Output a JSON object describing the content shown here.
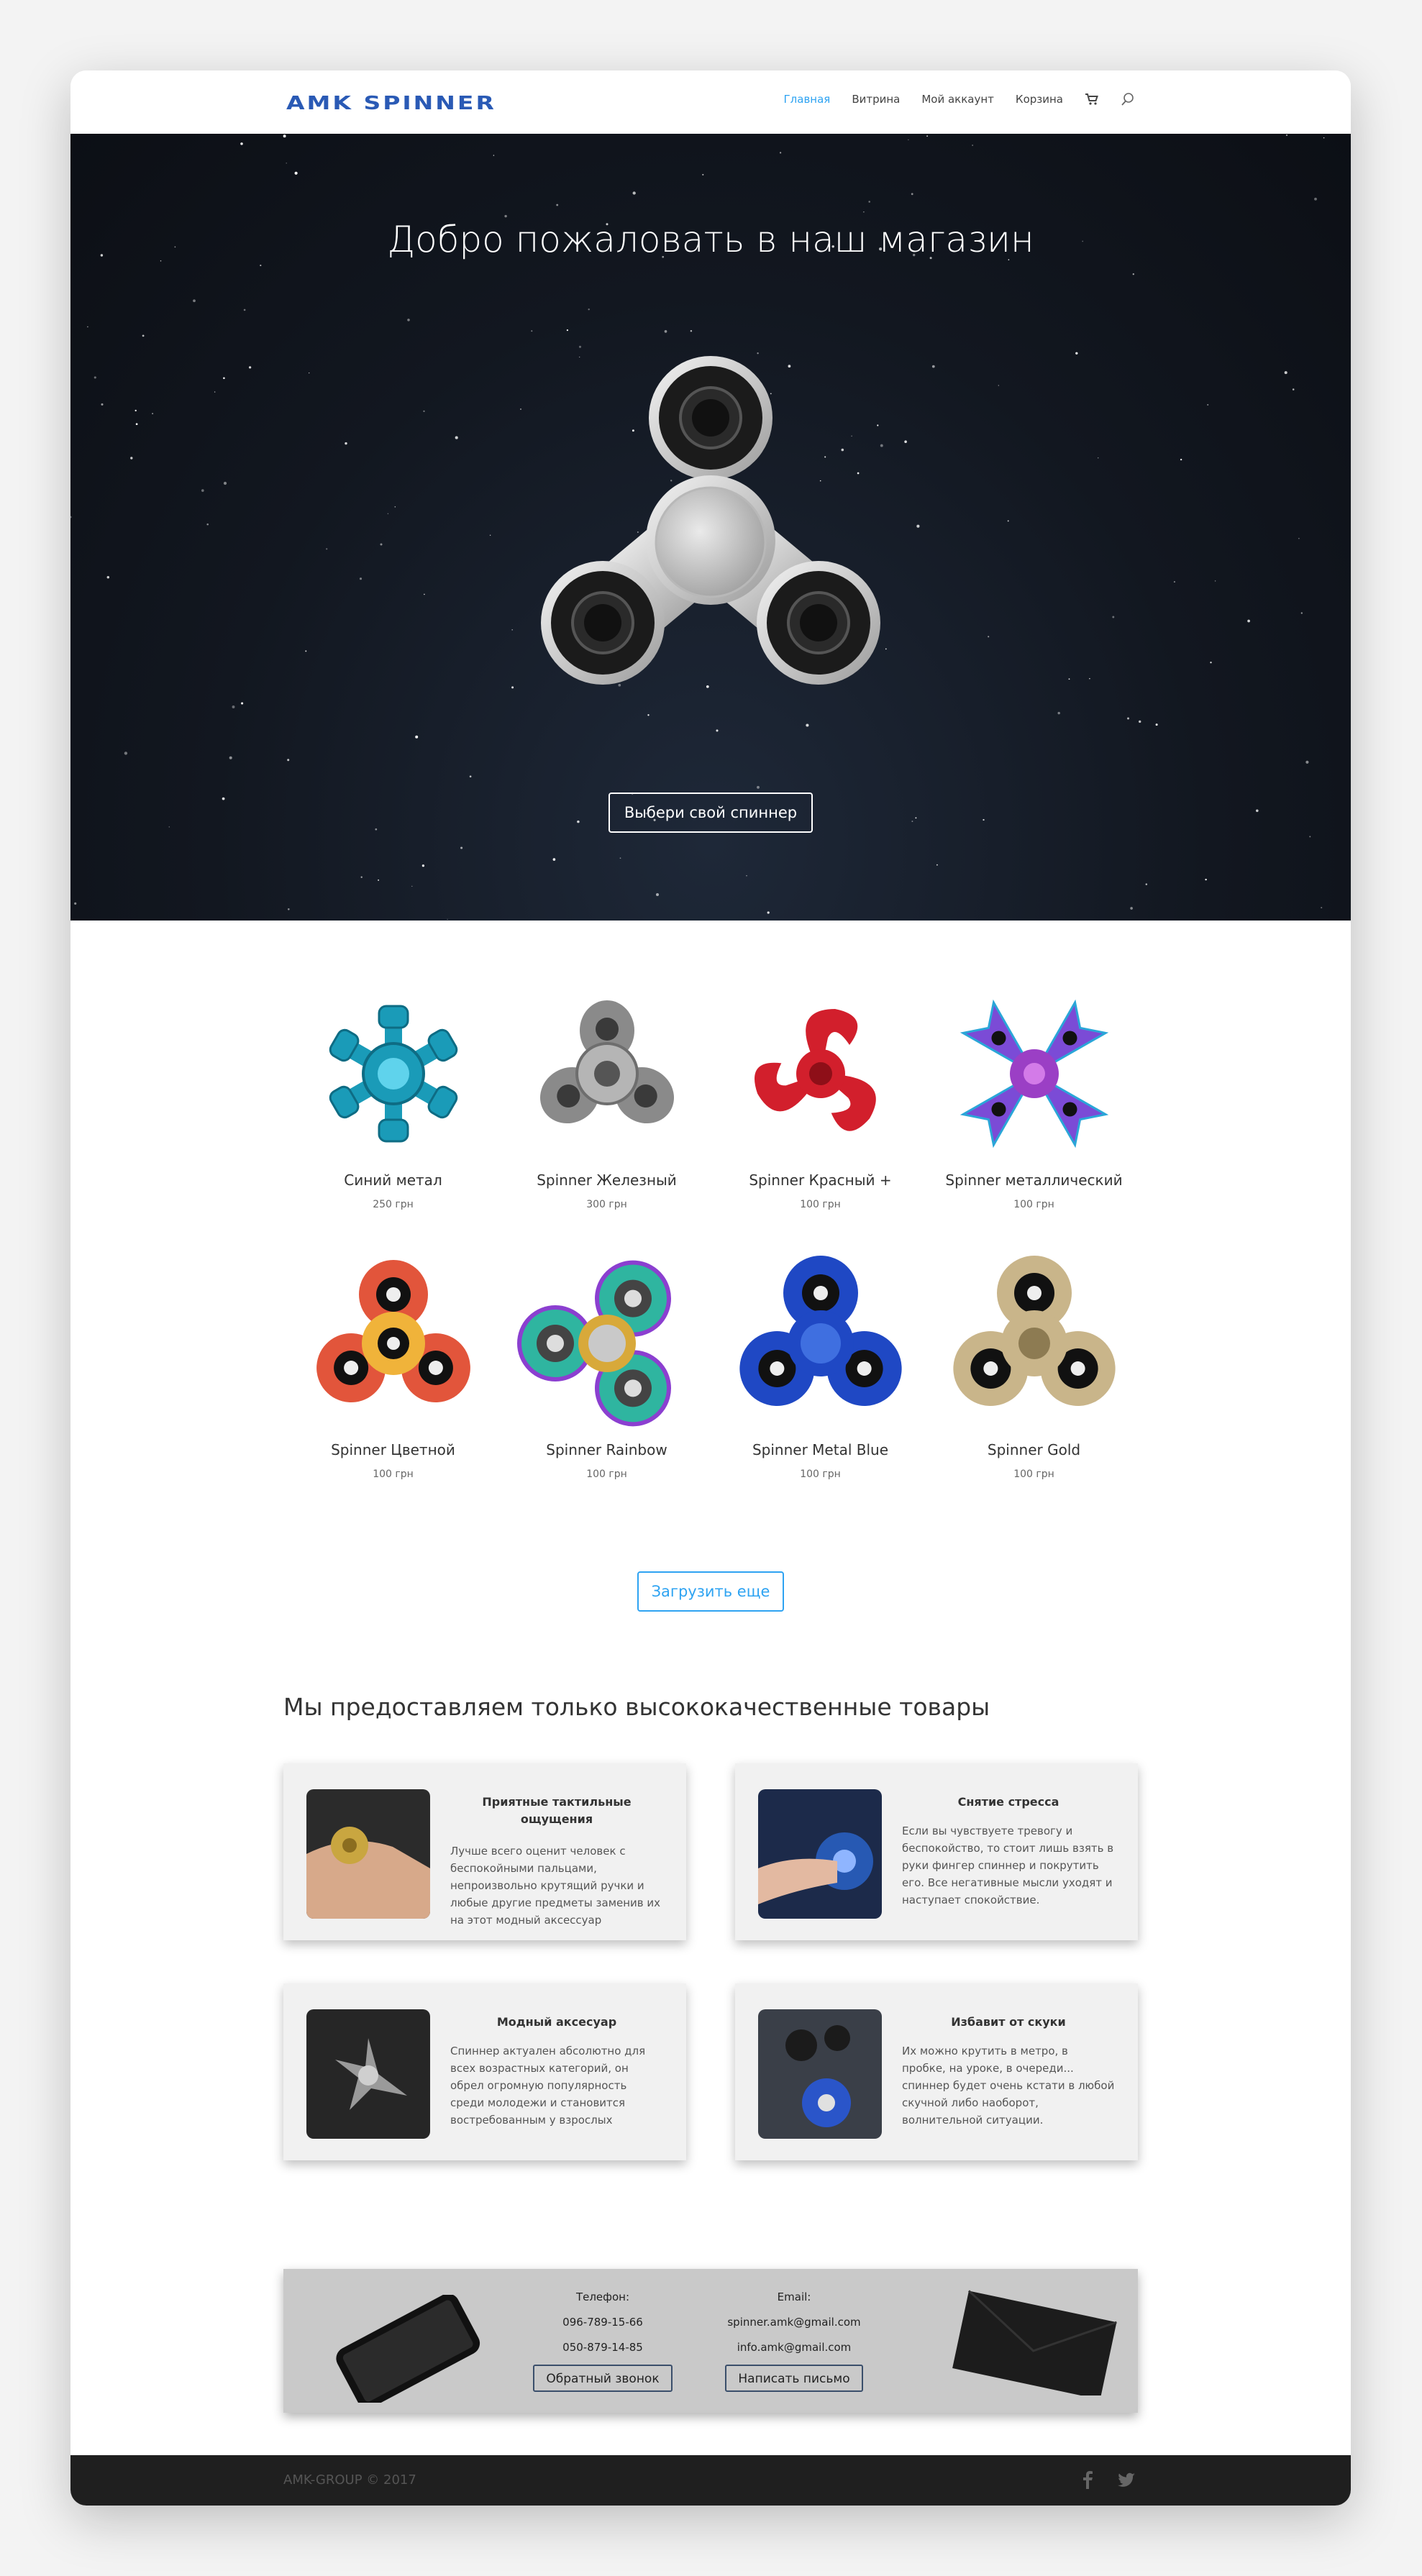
{
  "header": {
    "logo": "AMK SPINNER",
    "nav": [
      {
        "label": "Главная",
        "active": true
      },
      {
        "label": "Витрина",
        "active": false
      },
      {
        "label": "Мой аккаунт",
        "active": false
      },
      {
        "label": "Корзина",
        "active": false
      }
    ],
    "icons": [
      "cart-icon",
      "search-icon"
    ]
  },
  "hero": {
    "title": "Добро пожаловать в наш магазин",
    "button": "Выбери свой спиннер"
  },
  "products": [
    {
      "name": "Синий метал",
      "price": "250 грн",
      "color": "#1a9bb8"
    },
    {
      "name": "Spinner Железный",
      "price": "300 грн",
      "color": "#8a8a8a"
    },
    {
      "name": "Spinner Красный +",
      "price": "100 грн",
      "color": "#d21f2c"
    },
    {
      "name": "Spinner металлический",
      "price": "100 грн",
      "color": "#7b4bd6"
    },
    {
      "name": "Spinner Цветной",
      "price": "100 грн",
      "color": "#e2553b"
    },
    {
      "name": "Spinner Rainbow",
      "price": "100 грн",
      "color": "#2fb5a0"
    },
    {
      "name": "Spinner Metal Blue",
      "price": "100 грн",
      "color": "#1f48c4"
    },
    {
      "name": "Spinner Gold",
      "price": "100 грн",
      "color": "#c9b58a"
    }
  ],
  "load_more": "Загрузить еще",
  "quality_heading": "Мы предоставляем только высококачественные товары",
  "features": [
    {
      "title": "Приятные тактильные ощущения",
      "text": "Лучше всего оценит человек с беспокойными пальцами, непроизвольно крутящий ручки и любые другие предметы заменив их на этот модный аксессуар"
    },
    {
      "title": "Снятие стресса",
      "text": "Если вы чувствуете тревогу и беспокойство, то стоит лишь взять в руки фингер спиннер и покрутить его. Все негативные мысли уходят и наступает спокойствие."
    },
    {
      "title": "Модный аксесуар",
      "text": "Спиннер актуален абсолютно для всех возрастных категорий, он обрел огромную популярность среди молодежи и становится востребованным у взрослых"
    },
    {
      "title": "Избавит от скуки",
      "text": "Их можно крутить в метро, в пробке, на уроке, в очереди... спиннер будет очень кстати в любой скучной либо наоборот, волнительной ситуации."
    }
  ],
  "contacts": {
    "phone_label": "Телефон:",
    "phones": [
      "096-789-15-66",
      "050-879-14-85"
    ],
    "phone_button": "Обратный звонок",
    "email_label": "Email:",
    "emails": [
      "spinner.amk@gmail.com",
      "info.amk@gmail.com"
    ],
    "email_button": "Написать письмо"
  },
  "footer": {
    "copyright": "AMK-GROUP © 2017",
    "social": [
      "facebook-icon",
      "twitter-icon"
    ]
  },
  "colors": {
    "accent": "#2ea3f2",
    "logo": "#2a5ab5",
    "hero_bg": "#121720",
    "footer_bg": "#1f1f1f"
  }
}
